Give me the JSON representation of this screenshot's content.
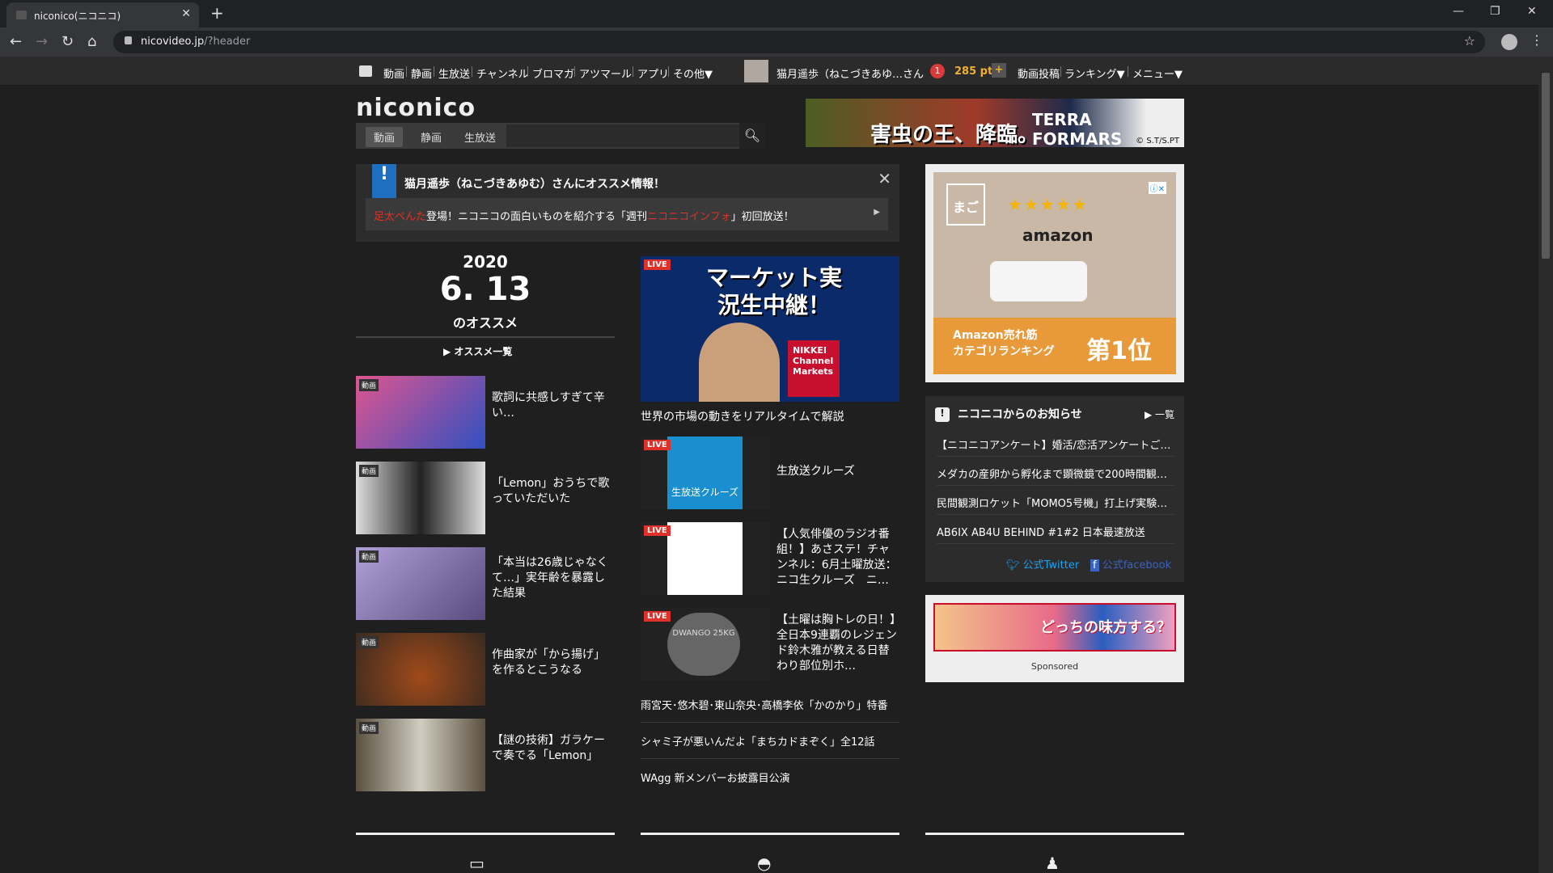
{
  "browser": {
    "tab_title": "niconico(ニコニコ)",
    "url_host": "nicovideo.jp",
    "url_path": "/?header"
  },
  "sitenav": {
    "items": [
      "動画",
      "静画",
      "生放送",
      "チャンネル",
      "ブロマガ",
      "アツマール",
      "アプリ",
      "その他▼"
    ],
    "username": "猫月遥歩（ねこづきあゆ…",
    "san": "さん",
    "notif_count": "1",
    "points": "285 pt",
    "plus": "+",
    "right_items": [
      "動画投稿",
      "ランキング▼",
      "メニュー▼"
    ]
  },
  "header": {
    "logo": "niconico",
    "search_tabs": [
      "動画",
      "静画",
      "生放送"
    ],
    "search_placeholder": ""
  },
  "banner_top": {
    "headline": "害虫の王、降臨。",
    "title": "TERRA FORMARS",
    "copyright": "© S.T/S.PT"
  },
  "notice": {
    "heading": "猫月遥歩（ねこづきあゆむ）さんにオススメ情報！",
    "msg_red1": "足太ぺんた",
    "msg_mid": "登場！ニコニコの面白いものを紹介する「週刊",
    "msg_red2": "ニコニコインフォ",
    "msg_end": "」初回放送！"
  },
  "reco": {
    "year": "2020",
    "monthday": "6. 13",
    "label": "のオススメ",
    "list_link": "▶ オススメ一覧",
    "cards": [
      {
        "badge": "動画",
        "title": "歌詞に共感しすぎて辛い…",
        "color": "#e05590"
      },
      {
        "badge": "動画",
        "title": "「Lemon」おうちで歌っていただいた",
        "color": "#cfcfcf"
      },
      {
        "badge": "動画",
        "title": "「本当は26歳じゃなくて…」実年齢を暴露した結果",
        "color": "#a08cc0"
      },
      {
        "badge": "動画",
        "title": "作曲家が「から揚げ」を作るとこうなる",
        "color": "#8a4a2a"
      },
      {
        "badge": "動画",
        "title": "【謎の技術】ガラケーで奏でる「Lemon」",
        "color": "#6a6a6a"
      }
    ]
  },
  "live": {
    "tag": "LIVE",
    "main_text": "マーケット実況生中継！",
    "nikkei": "NIKKEI Channel Markets",
    "main_caption": "世界の市場の動きをリアルタイムで解説",
    "cards": [
      {
        "title": "生放送クルーズ",
        "inner_text": "生放送クルーズ",
        "color": "#1a8fd0"
      },
      {
        "title": "【人気俳優のラジオ番組！】あさステ！チャンネル：6月土曜放送：ニコ生クルーズ　ニ…",
        "inner_text": "",
        "color": "#ffffff"
      },
      {
        "title": "【土曜は胸トレの日！】全日本9連覇のレジェンド鈴木雅が教える日替わり部位別ホ…",
        "inner_text": "DWANGO 25KG",
        "color": "#555555"
      }
    ],
    "links": [
      "雨宮天･悠木碧･東山奈央･高橋李依「かのかり」特番",
      "シャミ子が悪いんだよ「まちカドまぞく」全12話",
      "WAgg 新メンバーお披露目公演"
    ]
  },
  "ad1": {
    "channel": "まご",
    "stars": "★★★★★",
    "brand": "amazon",
    "band_line1": "Amazon売れ筋",
    "band_line2": "カテゴリランキング",
    "rank": "第1位",
    "adchoice": "ⓘ✕"
  },
  "news": {
    "heading": "ニコニコからのお知らせ",
    "all": "▶ 一覧",
    "items": [
      "【ニコニコアンケート】婚活/恋活アンケートご…",
      "メダカの産卵から孵化まで顕微鏡で200時間観…",
      "民間観測ロケット「MOMO5号機」打上げ実験…",
      "AB6IX AB4U BEHIND #1#2 日本最速放送"
    ],
    "twitter": "公式Twitter",
    "facebook": "公式facebook"
  },
  "ad2": {
    "text": "どっちの味方する？",
    "sponsored": "Sponsored"
  }
}
